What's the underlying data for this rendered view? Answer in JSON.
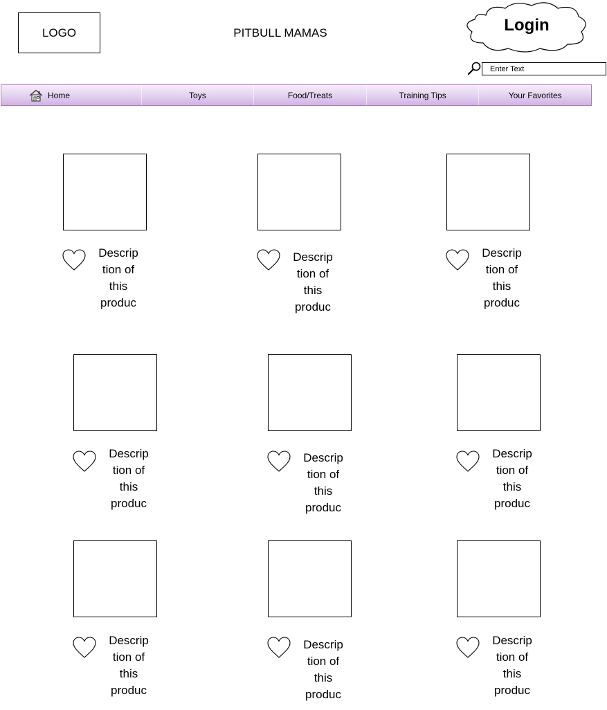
{
  "header": {
    "logo_text": "LOGO",
    "site_title": "PITBULL MAMAS",
    "login_label": "Login",
    "search": {
      "placeholder": "Enter Text",
      "icon": "search-icon"
    }
  },
  "nav": {
    "items": [
      {
        "label": "Home",
        "icon": "home-icon"
      },
      {
        "label": "Toys"
      },
      {
        "label": "Food/Treats"
      },
      {
        "label": "Training Tips"
      },
      {
        "label": "Your Favorites"
      }
    ]
  },
  "colors": {
    "nav_gradient_top": "#f6eefb",
    "nav_gradient_bottom": "#d2b1e5",
    "nav_border": "#a57cc0"
  },
  "products": [
    {
      "description": "Descrip\ntion of\nthis\nproduc",
      "icon": "heart-icon"
    },
    {
      "description": "Descrip\ntion of\nthis\nproduc",
      "icon": "heart-icon"
    },
    {
      "description": "Descrip\ntion of\nthis\nproduc",
      "icon": "heart-icon"
    },
    {
      "description": "Descrip\ntion of\nthis\nproduc",
      "icon": "heart-icon"
    },
    {
      "description": "Descrip\ntion of\nthis\nproduc",
      "icon": "heart-icon"
    },
    {
      "description": "Descrip\ntion of\nthis\nproduc",
      "icon": "heart-icon"
    },
    {
      "description": "Descrip\ntion of\nthis\nproduc",
      "icon": "heart-icon"
    },
    {
      "description": "Descrip\ntion of\nthis\nproduc",
      "icon": "heart-icon"
    },
    {
      "description": "Descrip\ntion of\nthis\nproduc",
      "icon": "heart-icon"
    }
  ]
}
